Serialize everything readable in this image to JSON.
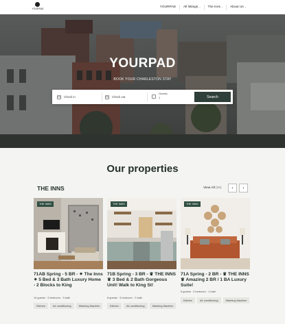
{
  "brand": {
    "name": "YOURPAD"
  },
  "nav": {
    "items": [
      {
        "label": "YOURPAD",
        "caret": ""
      },
      {
        "label": "All listings",
        "caret": "›"
      },
      {
        "label": "The inns",
        "caret": "›"
      },
      {
        "label": "About Us",
        "caret": "›"
      }
    ]
  },
  "hero": {
    "title": "YOURPAD",
    "subtitle": "BOOK YOUR CHARLESTON STAY"
  },
  "search": {
    "checkin_label": "Check in",
    "checkout_label": "Check out",
    "guests_label": "Guests",
    "guests_value": "1",
    "button": "Search"
  },
  "properties": {
    "heading": "Our properties",
    "section": "THE INNS",
    "view_all": "View All",
    "view_all_count": "(20)",
    "prev_icon": "‹",
    "next_icon": "›",
    "cards": [
      {
        "badge": "THE INNS",
        "title": "71AB Spring - 5 BR - ⁕ The Inns ⁕ 5 Bed & 3 Bath Luxury Home - 2 Blocks to King",
        "meta": "14 guests · 5 bedroom · 3 bath",
        "amenities": [
          "Kitchen",
          "Air conditioning",
          "Washing Machine"
        ]
      },
      {
        "badge": "THE INNS",
        "title": "71B Spring - 3 BR - ♛ THE INNS ♛ 3 Bed & 2 Bath Gorgeous Unit! Walk to King St!",
        "meta": "8 guests · 3 bedroom · 2 bath",
        "amenities": [
          "Kitchen",
          "Air conditioning",
          "Washing Machine"
        ]
      },
      {
        "badge": "THE INNS",
        "title": "71A Spring - 2 BR - ♛ THE INNS ♛ Amazing 2 BR / 1 BA Luxury Suite!",
        "meta": "6 guests · 2 bedroom · 1 bath",
        "amenities": [
          "Kitchen",
          "Air conditioning",
          "Washing Machine"
        ]
      }
    ]
  },
  "colors": {
    "accent": "#2f3f39",
    "badge": "#2f4e41",
    "chip": "#e6e6e3"
  }
}
